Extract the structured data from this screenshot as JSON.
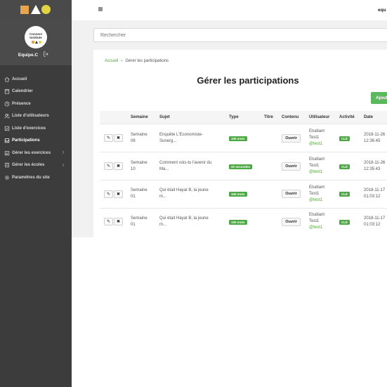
{
  "sidebar": {
    "avatar_text_line1": "Connect",
    "avatar_text_line2": "Institute",
    "username": "Equipe.C",
    "menu": [
      {
        "label": "Accueil",
        "icon": "home-icon"
      },
      {
        "label": "Calendrier",
        "icon": "calendar-icon"
      },
      {
        "label": "Présence",
        "icon": "clock-icon"
      },
      {
        "label": "Liste d'utilisateurs",
        "icon": "users-icon"
      },
      {
        "label": "Liste d'exercices",
        "icon": "checklist-icon"
      },
      {
        "label": "Participations",
        "icon": "inbox-icon"
      },
      {
        "label": "Gérer les exercices",
        "icon": "exercise-icon"
      },
      {
        "label": "Gérer les écoles",
        "icon": "school-icon"
      },
      {
        "label": "Paramètres du site",
        "icon": "gear-icon"
      }
    ]
  },
  "topbar": {
    "user": "equ"
  },
  "search": {
    "placeholder": "Rechercher"
  },
  "breadcrumb": {
    "home": "Accueil",
    "separator": "›",
    "current": "Gérer les participations"
  },
  "page": {
    "title": "Gérer les participations",
    "add_button": "Ajout"
  },
  "table": {
    "headers": {
      "semaine": "Semaine",
      "sujet": "Sujet",
      "type": "Type",
      "titre": "Titre",
      "contenu": "Contenu",
      "utilisateur": "Utilisateur",
      "activite": "Activité",
      "date": "Date"
    },
    "rows": [
      {
        "semaine": [
          "Semaine",
          "08"
        ],
        "sujet": [
          "Enquête L'Economiste-",
          "Sunerg..."
        ],
        "type": "100 mots",
        "titre": "",
        "contenu": "Ouvrir",
        "user": [
          "Etudiant",
          "Test1",
          "@test1"
        ],
        "activite": "CLÉ",
        "date": [
          "2018-11-26",
          "12:36:45"
        ]
      },
      {
        "semaine": [
          "Semaine",
          "10"
        ],
        "sujet": [
          "Comment vois-tu l'avenir du",
          "Ma..."
        ],
        "type": "20 secondes",
        "titre": "",
        "contenu": "Ouvrir",
        "user": [
          "Etudiant",
          "Test1",
          "@test1"
        ],
        "activite": "CLÉ",
        "date": [
          "2018-11-26",
          "12:35:43"
        ]
      },
      {
        "semaine": [
          "Semaine",
          "01"
        ],
        "sujet": [
          "Qui était Hayat B, la jeune",
          "m..."
        ],
        "type": "100 mots",
        "titre": "",
        "contenu": "Ouvrir",
        "user": [
          "Etudiant",
          "Test1",
          "@test1"
        ],
        "activite": "CLÉ",
        "date": [
          "2018-11-17",
          "01:03:12"
        ]
      },
      {
        "semaine": [
          "Semaine",
          "01"
        ],
        "sujet": [
          "Qui était Hayat B, la jeune",
          "m..."
        ],
        "type": "100 mots",
        "titre": "",
        "contenu": "Ouvrir",
        "user": [
          "Etudiant",
          "Test1",
          "@test1"
        ],
        "activite": "CLÉ",
        "date": [
          "2018-11-17",
          "01:03:12"
        ]
      }
    ]
  },
  "colors": {
    "sidebar_bg": "#3c3c3c",
    "accent_green": "#4ca842",
    "logo_orange": "#e8a44a",
    "logo_yellow": "#e3d33e"
  }
}
